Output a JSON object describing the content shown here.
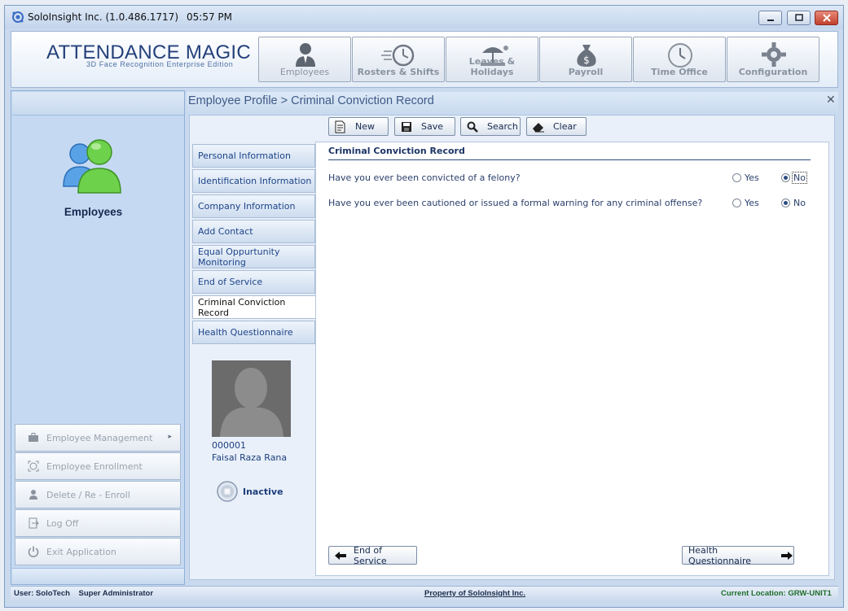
{
  "window": {
    "app_name": "SoloInsight Inc. (1.0.486.1717)",
    "time": "05:57 PM",
    "icon": "app-logo-icon"
  },
  "brand": {
    "name": "ATTENDANCE MAGIC",
    "subtitle": "3D Face Recognition Enterprise Edition"
  },
  "nav": [
    {
      "label": "Employees",
      "icon": "employee-icon",
      "selected": true
    },
    {
      "label": "Rosters & Shifts",
      "icon": "stopwatch-icon"
    },
    {
      "label": "Leaves & Holidays",
      "icon": "beach-umbrella-icon"
    },
    {
      "label": "Payroll",
      "icon": "money-bag-icon"
    },
    {
      "label": "Time Office",
      "icon": "clock-icon"
    },
    {
      "label": "Configuration",
      "icon": "gear-icon"
    }
  ],
  "sidebar": {
    "title": "Employees",
    "menu": [
      {
        "label": "Employee Management",
        "icon": "briefcase-icon"
      },
      {
        "label": "Employee Enrollment",
        "icon": "face-scan-icon"
      },
      {
        "label": "Delete / Re - Enroll",
        "icon": "person-delete-icon"
      },
      {
        "label": "Log Off",
        "icon": "log-off-icon"
      },
      {
        "label": "Exit Application",
        "icon": "power-icon"
      }
    ]
  },
  "breadcrumb": "Employee Profile > Criminal Conviction Record",
  "toolbar": {
    "new": "New",
    "save": "Save",
    "search": "Search",
    "clear": "Clear"
  },
  "tabs": [
    "Personal Information",
    "Identification Information",
    "Company Information",
    "Add Contact",
    "Equal Oppurtunity Monitoring",
    "End of Service",
    "Criminal Conviction Record",
    "Health Questionnaire"
  ],
  "active_tab_index": 6,
  "employee": {
    "id": "000001",
    "name": "Faisal Raza Rana",
    "status": "Inactive"
  },
  "form": {
    "section_title": "Criminal Conviction Record",
    "yes_label": "Yes",
    "no_label": "No",
    "questions": [
      {
        "text": "Have you ever been convicted of a felony?",
        "answer": "No"
      },
      {
        "text": "Have you ever been cautioned or issued a formal warning for any criminal offense?",
        "answer": "No"
      }
    ]
  },
  "footer_nav": {
    "prev": "End of Service",
    "next": "Health Questionnaire"
  },
  "statusbar": {
    "user": "User: SoloTech    Super Administrator",
    "property": "Property of SoloInsight Inc.",
    "location": "Current Location: GRW-UNIT1"
  },
  "colors": {
    "brand": "#24407a",
    "status_location": "#1f6d2a",
    "close_button": "#c0402c"
  }
}
